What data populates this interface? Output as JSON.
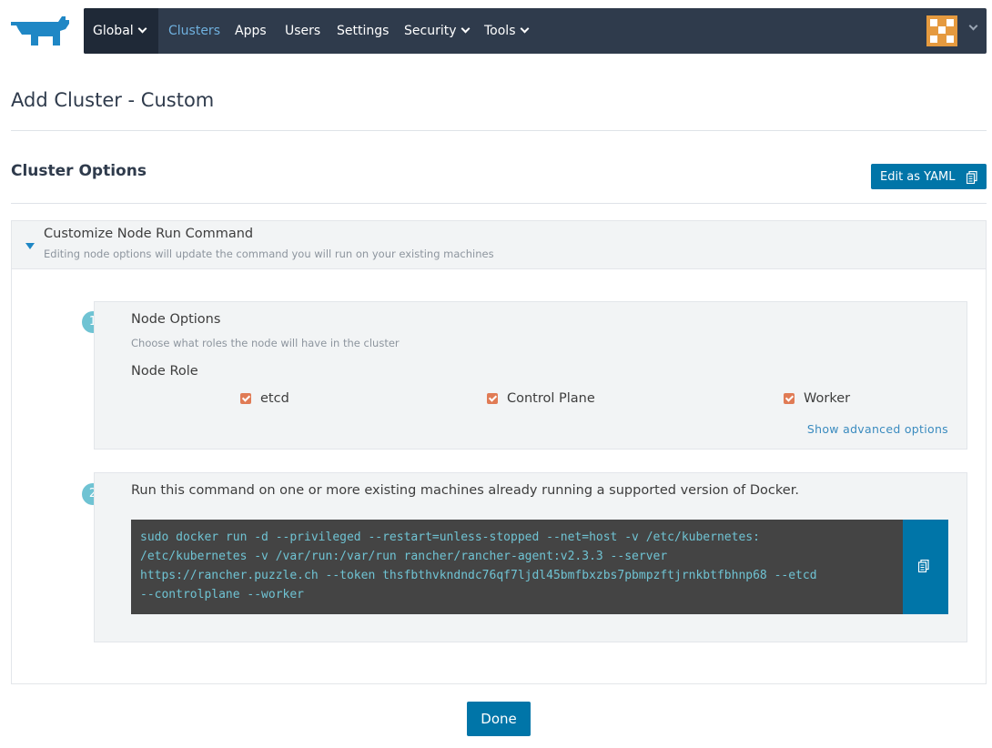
{
  "nav": {
    "global": "Global",
    "items": [
      "Clusters",
      "Apps",
      "Users",
      "Settings",
      "Security",
      "Tools"
    ],
    "active": "Clusters"
  },
  "page": {
    "title": "Add Cluster - Custom",
    "section_title": "Cluster Options",
    "yaml_button": "Edit as YAML",
    "done_button": "Done"
  },
  "accordion": {
    "title": "Customize Node Run Command",
    "subtitle": "Editing node options will update the command you will run on your existing machines"
  },
  "step1": {
    "number": "1",
    "title": "Node Options",
    "subtitle": "Choose what roles the node will have in the cluster",
    "role_label": "Node Role",
    "roles": [
      {
        "label": "etcd",
        "checked": true
      },
      {
        "label": "Control Plane",
        "checked": true
      },
      {
        "label": "Worker",
        "checked": true
      }
    ],
    "advanced_link": "Show advanced options"
  },
  "step2": {
    "number": "2",
    "instruction": "Run this command on one or more existing machines already running a supported version of Docker.",
    "command_lines": [
      "sudo docker run -d --privileged --restart=unless-stopped --net=host -v /etc/kubernetes:",
      "/etc/kubernetes -v /var/run:/var/run rancher/rancher-agent:v2.3.3 --server",
      "https://rancher.puzzle.ch --token thsfbthvkndndc76qf7ljdl45bmfbxzbs7pbmpzftjrnkbtfbhnp68 --etcd",
      "--controlplane --worker"
    ]
  },
  "colors": {
    "navbar": "#2f3b4c",
    "primary": "#0075a8",
    "accent_link": "#6fb0de",
    "checkbox": "#e07b55",
    "step_badge": "#6fc3d3"
  }
}
